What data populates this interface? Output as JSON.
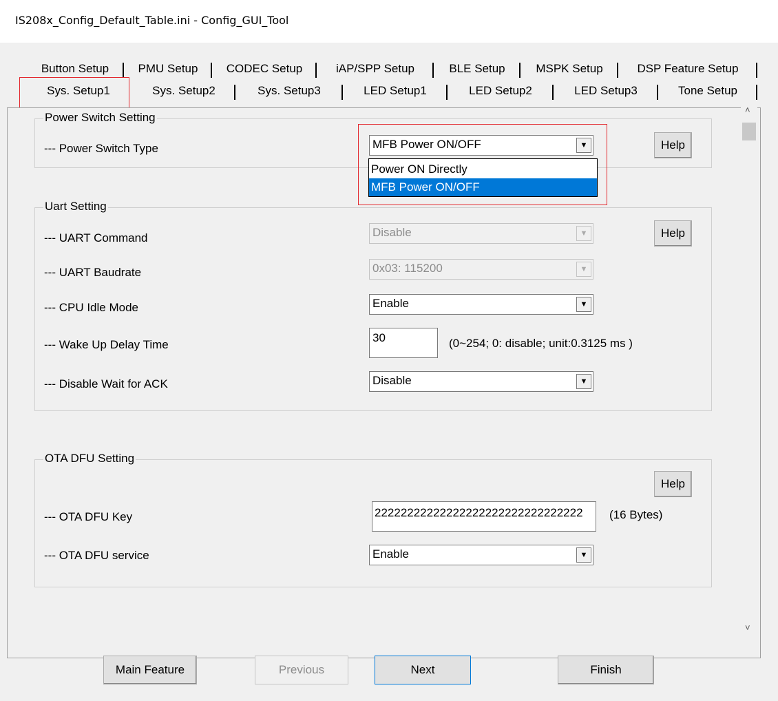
{
  "window": {
    "title": "IS208x_Config_Default_Table.ini - Config_GUI_Tool"
  },
  "tabs_row1": [
    "Button Setup",
    "PMU Setup",
    "CODEC Setup",
    "iAP/SPP Setup",
    "BLE Setup",
    "MSPK Setup",
    "DSP Feature Setup"
  ],
  "tabs_row2": [
    "Sys. Setup1",
    "Sys. Setup2",
    "Sys. Setup3",
    "LED Setup1",
    "LED Setup2",
    "LED Setup3",
    "Tone Setup"
  ],
  "selected_tab": "Sys. Setup1",
  "power": {
    "title": "Power Switch Setting",
    "type_label": "--- Power Switch Type",
    "type_value": "MFB Power ON/OFF",
    "options": [
      "Power ON Directly",
      "MFB Power ON/OFF"
    ],
    "help": "Help"
  },
  "uart": {
    "title": "Uart Setting",
    "command_label": "--- UART Command",
    "command_value": "Disable",
    "baud_label": "--- UART Baudrate",
    "baud_value": "0x03: 115200",
    "idle_label": "--- CPU Idle Mode",
    "idle_value": "Enable",
    "wake_label": "--- Wake Up Delay Time",
    "wake_value": "30",
    "wake_hint": "(0~254; 0: disable; unit:0.3125 ms )",
    "ack_label": "--- Disable Wait for ACK",
    "ack_value": "Disable",
    "help": "Help"
  },
  "ota": {
    "title": "OTA DFU Setting",
    "key_label": "--- OTA DFU Key",
    "key_value": "22222222222222222222222222222222",
    "key_hint": "(16 Bytes)",
    "service_label": "--- OTA DFU service",
    "service_value": "Enable",
    "help": "Help"
  },
  "buttons": {
    "main": "Main Feature",
    "previous": "Previous",
    "next": "Next",
    "finish": "Finish"
  }
}
